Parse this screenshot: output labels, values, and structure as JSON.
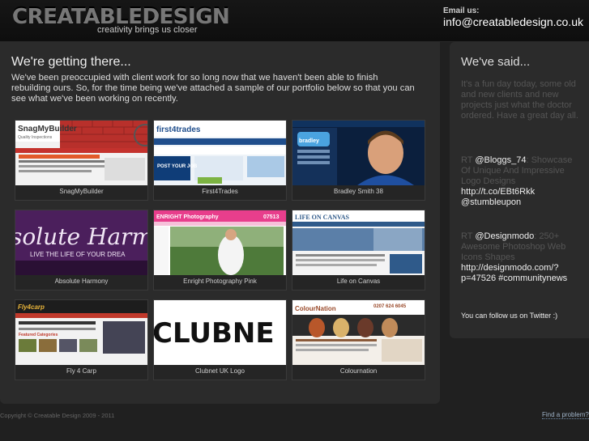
{
  "header": {
    "logo": "CREATABLEDESIGN",
    "tagline": "creativity brings us closer",
    "email_label": "Email us:",
    "email": "info@creatabledesign.co.uk"
  },
  "main": {
    "title": "We're getting there...",
    "intro": "We've been preoccupied with client work for so long now that we haven't been able to finish rebuilding ours. So, for the time being we've attached a sample of our portfolio below so that you can see what we've been working on recently.",
    "portfolio": [
      {
        "caption": "SnagMyBuilder",
        "thumb_text": "SnagMyBuilder",
        "thumb_sub": "Quality Inspections"
      },
      {
        "caption": "First4Trades",
        "thumb_text": "first4trades",
        "thumb_sub": "POST YOUR JOB"
      },
      {
        "caption": "Bradley Smith 38",
        "thumb_text": "bradley",
        "thumb_sub": ""
      },
      {
        "caption": "Absolute Harmony",
        "thumb_text": "solute Harm",
        "thumb_sub": "LIVE THE LIFE OF YOUR DREA"
      },
      {
        "caption": "Enright Photography Pink",
        "thumb_text": "ENRIGHT Photography",
        "thumb_sub": "07513"
      },
      {
        "caption": "Life on Canvas",
        "thumb_text": "LIFE ON CANVAS",
        "thumb_sub": ""
      },
      {
        "caption": "Fly 4 Carp",
        "thumb_text": "Fly4carp",
        "thumb_sub": "Featured Categories"
      },
      {
        "caption": "Clubnet UK Logo",
        "thumb_text": "CLUBNE",
        "thumb_sub": ""
      },
      {
        "caption": "Colournation",
        "thumb_text": "ColourNation",
        "thumb_sub": "0207 624 6045"
      }
    ]
  },
  "sidebar": {
    "title": "We've said...",
    "tweets": [
      {
        "text": "It's a fun day today, some old and new clients and new projects just what the doctor ordered. Have a great day all.",
        "link": ""
      },
      {
        "prefix": "RT ",
        "handle": "@Bloggs_74",
        "text": ": Showcase Of Unique And Impressive Logo Designs ",
        "link": "http://t.co/EBt6Rkk @stumbleupon"
      },
      {
        "prefix": "RT ",
        "handle": "@Designmodo",
        "text": ": 250+ Awesome Photoshop Web Icons Shapes ",
        "link": "http://designmodo.com/?p=47526 #communitynews"
      }
    ],
    "follow": "You can follow us on Twitter :)"
  },
  "footer": {
    "copyright": "Copyright © Creatable Design 2009 - 2011",
    "problem": "Find a problem?"
  },
  "colors": {
    "background": "#202020",
    "panel": "#2b2b2b",
    "tweet_text": "#555555",
    "link": "#9fb3c8"
  }
}
